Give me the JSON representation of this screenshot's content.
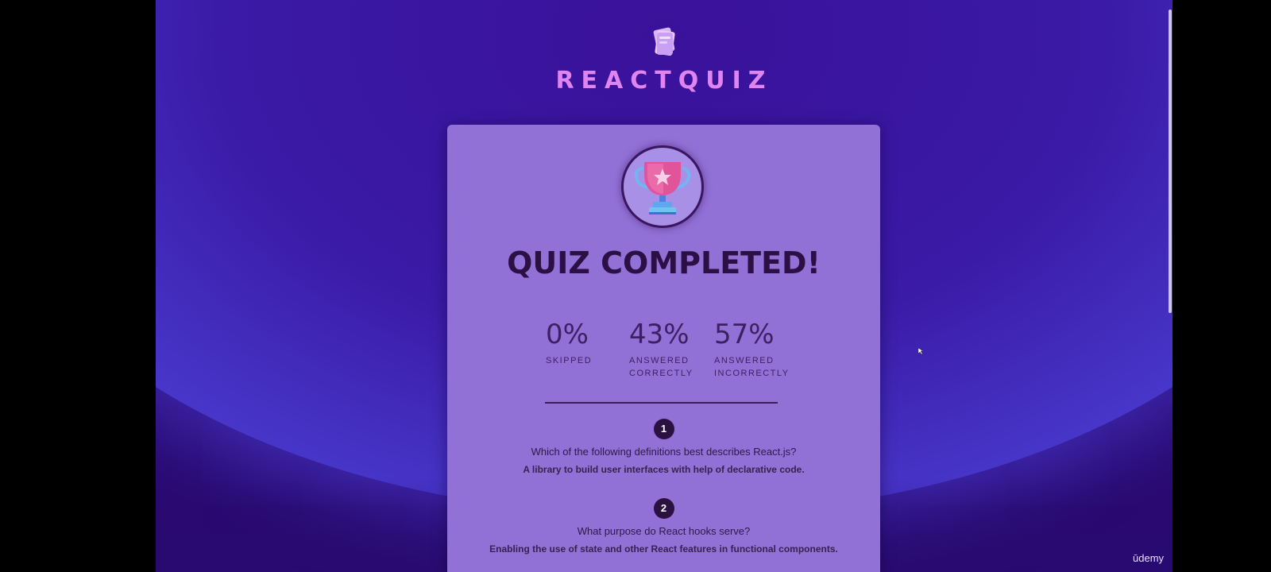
{
  "app": {
    "title": "REACTQUIZ"
  },
  "summary": {
    "heading": "QUIZ COMPLETED!",
    "stats": [
      {
        "value": "0%",
        "label_line1": "SKIPPED",
        "label_line2": ""
      },
      {
        "value": "43%",
        "label_line1": "ANSWERED",
        "label_line2": "CORRECTLY"
      },
      {
        "value": "57%",
        "label_line1": "ANSWERED",
        "label_line2": "INCORRECTLY"
      }
    ]
  },
  "answers": [
    {
      "number": "1",
      "question": "Which of the following definitions best describes React.js?",
      "answer": "A library to build user interfaces with help of declarative code."
    },
    {
      "number": "2",
      "question": "What purpose do React hooks serve?",
      "answer": "Enabling the use of state and other React features in functional components."
    }
  ],
  "watermark": "ūdemy",
  "icons": {
    "logo": "quiz-logo-icon",
    "trophy": "trophy-icon",
    "cursor": "mouse-cursor-icon"
  },
  "colors": {
    "title_accent": "#e084f0",
    "card_background": "#9271d6",
    "page_background": "#2c0a78"
  }
}
